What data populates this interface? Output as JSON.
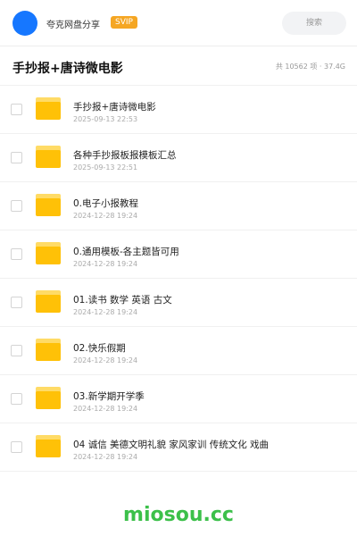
{
  "header": {
    "share_name": "夸克网盘分享",
    "badge": "SVIP",
    "search_placeholder": "搜索"
  },
  "folder": {
    "title": "手抄报+唐诗微电影",
    "stats": "共 10562 项 · 37.4G"
  },
  "items": [
    {
      "name": "手抄报+唐诗微电影",
      "time": "2025-09-13 22:53",
      "icon": "folder-icon"
    },
    {
      "name": "各种手抄报板报模板汇总",
      "time": "2025-09-13 22:51",
      "icon": "folder-icon"
    },
    {
      "name": "0.电子小报教程",
      "time": "2024-12-28 19:24",
      "icon": "folder-icon"
    },
    {
      "name": "0.通用模板-各主题皆可用",
      "time": "2024-12-28 19:24",
      "icon": "folder-icon"
    },
    {
      "name": "01.读书 数学 英语 古文",
      "time": "2024-12-28 19:24",
      "icon": "folder-icon"
    },
    {
      "name": "02.快乐假期",
      "time": "2024-12-28 19:24",
      "icon": "folder-icon"
    },
    {
      "name": "03.新学期开学季",
      "time": "2024-12-28 19:24",
      "icon": "folder-icon"
    },
    {
      "name": "04 诚信 美德文明礼貌 家风家训 传统文化 戏曲",
      "time": "2024-12-28 19:24",
      "icon": "folder-icon"
    }
  ],
  "watermark": "miosou.cc",
  "colors": {
    "avatar": "#1677ff",
    "badge": "#f5a623",
    "folder": "#ffc107",
    "watermark": "#3cc04a"
  }
}
